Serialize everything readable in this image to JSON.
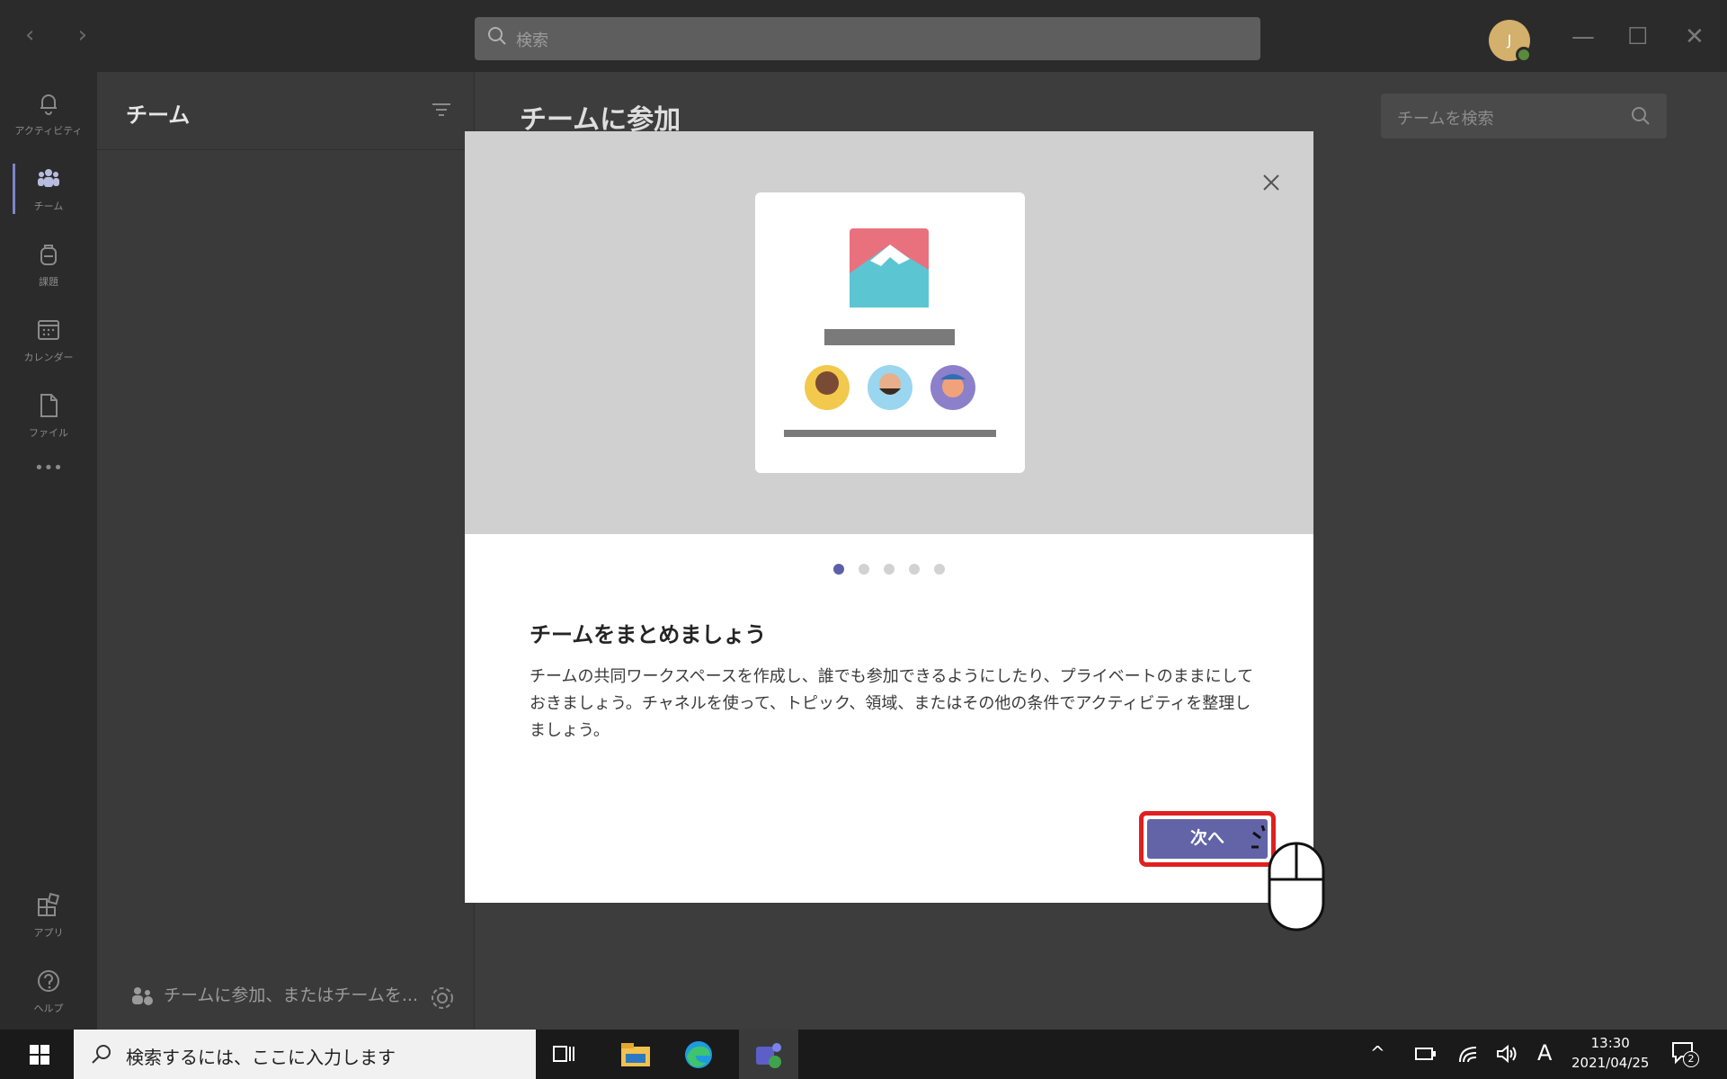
{
  "titlebar": {
    "nav_arrows": "‹ ›",
    "search_placeholder": "検索",
    "avatar_initial": "J",
    "minimize": "—",
    "maximize": "☐",
    "close": "✕"
  },
  "rail": {
    "items": [
      {
        "label": "アクティビティ",
        "icon": "bell-icon"
      },
      {
        "label": "チーム",
        "icon": "teams-icon"
      },
      {
        "label": "課題",
        "icon": "backpack-icon"
      },
      {
        "label": "カレンダー",
        "icon": "calendar-icon"
      },
      {
        "label": "ファイル",
        "icon": "file-icon"
      },
      {
        "label": "•••",
        "icon": "more-icon"
      }
    ],
    "bottom": [
      {
        "label": "アプリ",
        "icon": "apps-icon"
      },
      {
        "label": "ヘルプ",
        "icon": "help-icon"
      }
    ]
  },
  "teams_panel": {
    "header": "チーム",
    "footer_label": "チームに参加、またはチームを..."
  },
  "main": {
    "title": "チームに参加",
    "search_placeholder": "チームを検索"
  },
  "modal": {
    "heading": "チームをまとめましょう",
    "description": "チームの共同ワークスペースを作成し、誰でも参加できるようにしたり、プライベートのままにしておきましょう。チャネルを使って、トピック、領域、またはその他の条件でアクティビティを整理しましょう。",
    "next_button": "次へ",
    "page_indicator": {
      "current": 1,
      "total": 5
    }
  },
  "taskbar": {
    "search_placeholder": "検索するには、ここに入力します",
    "time": "13:30",
    "date": "2021/04/25",
    "ime": "A",
    "notification_count": "2"
  },
  "colors": {
    "accent": "#6264a7",
    "highlight": "#e02020"
  }
}
